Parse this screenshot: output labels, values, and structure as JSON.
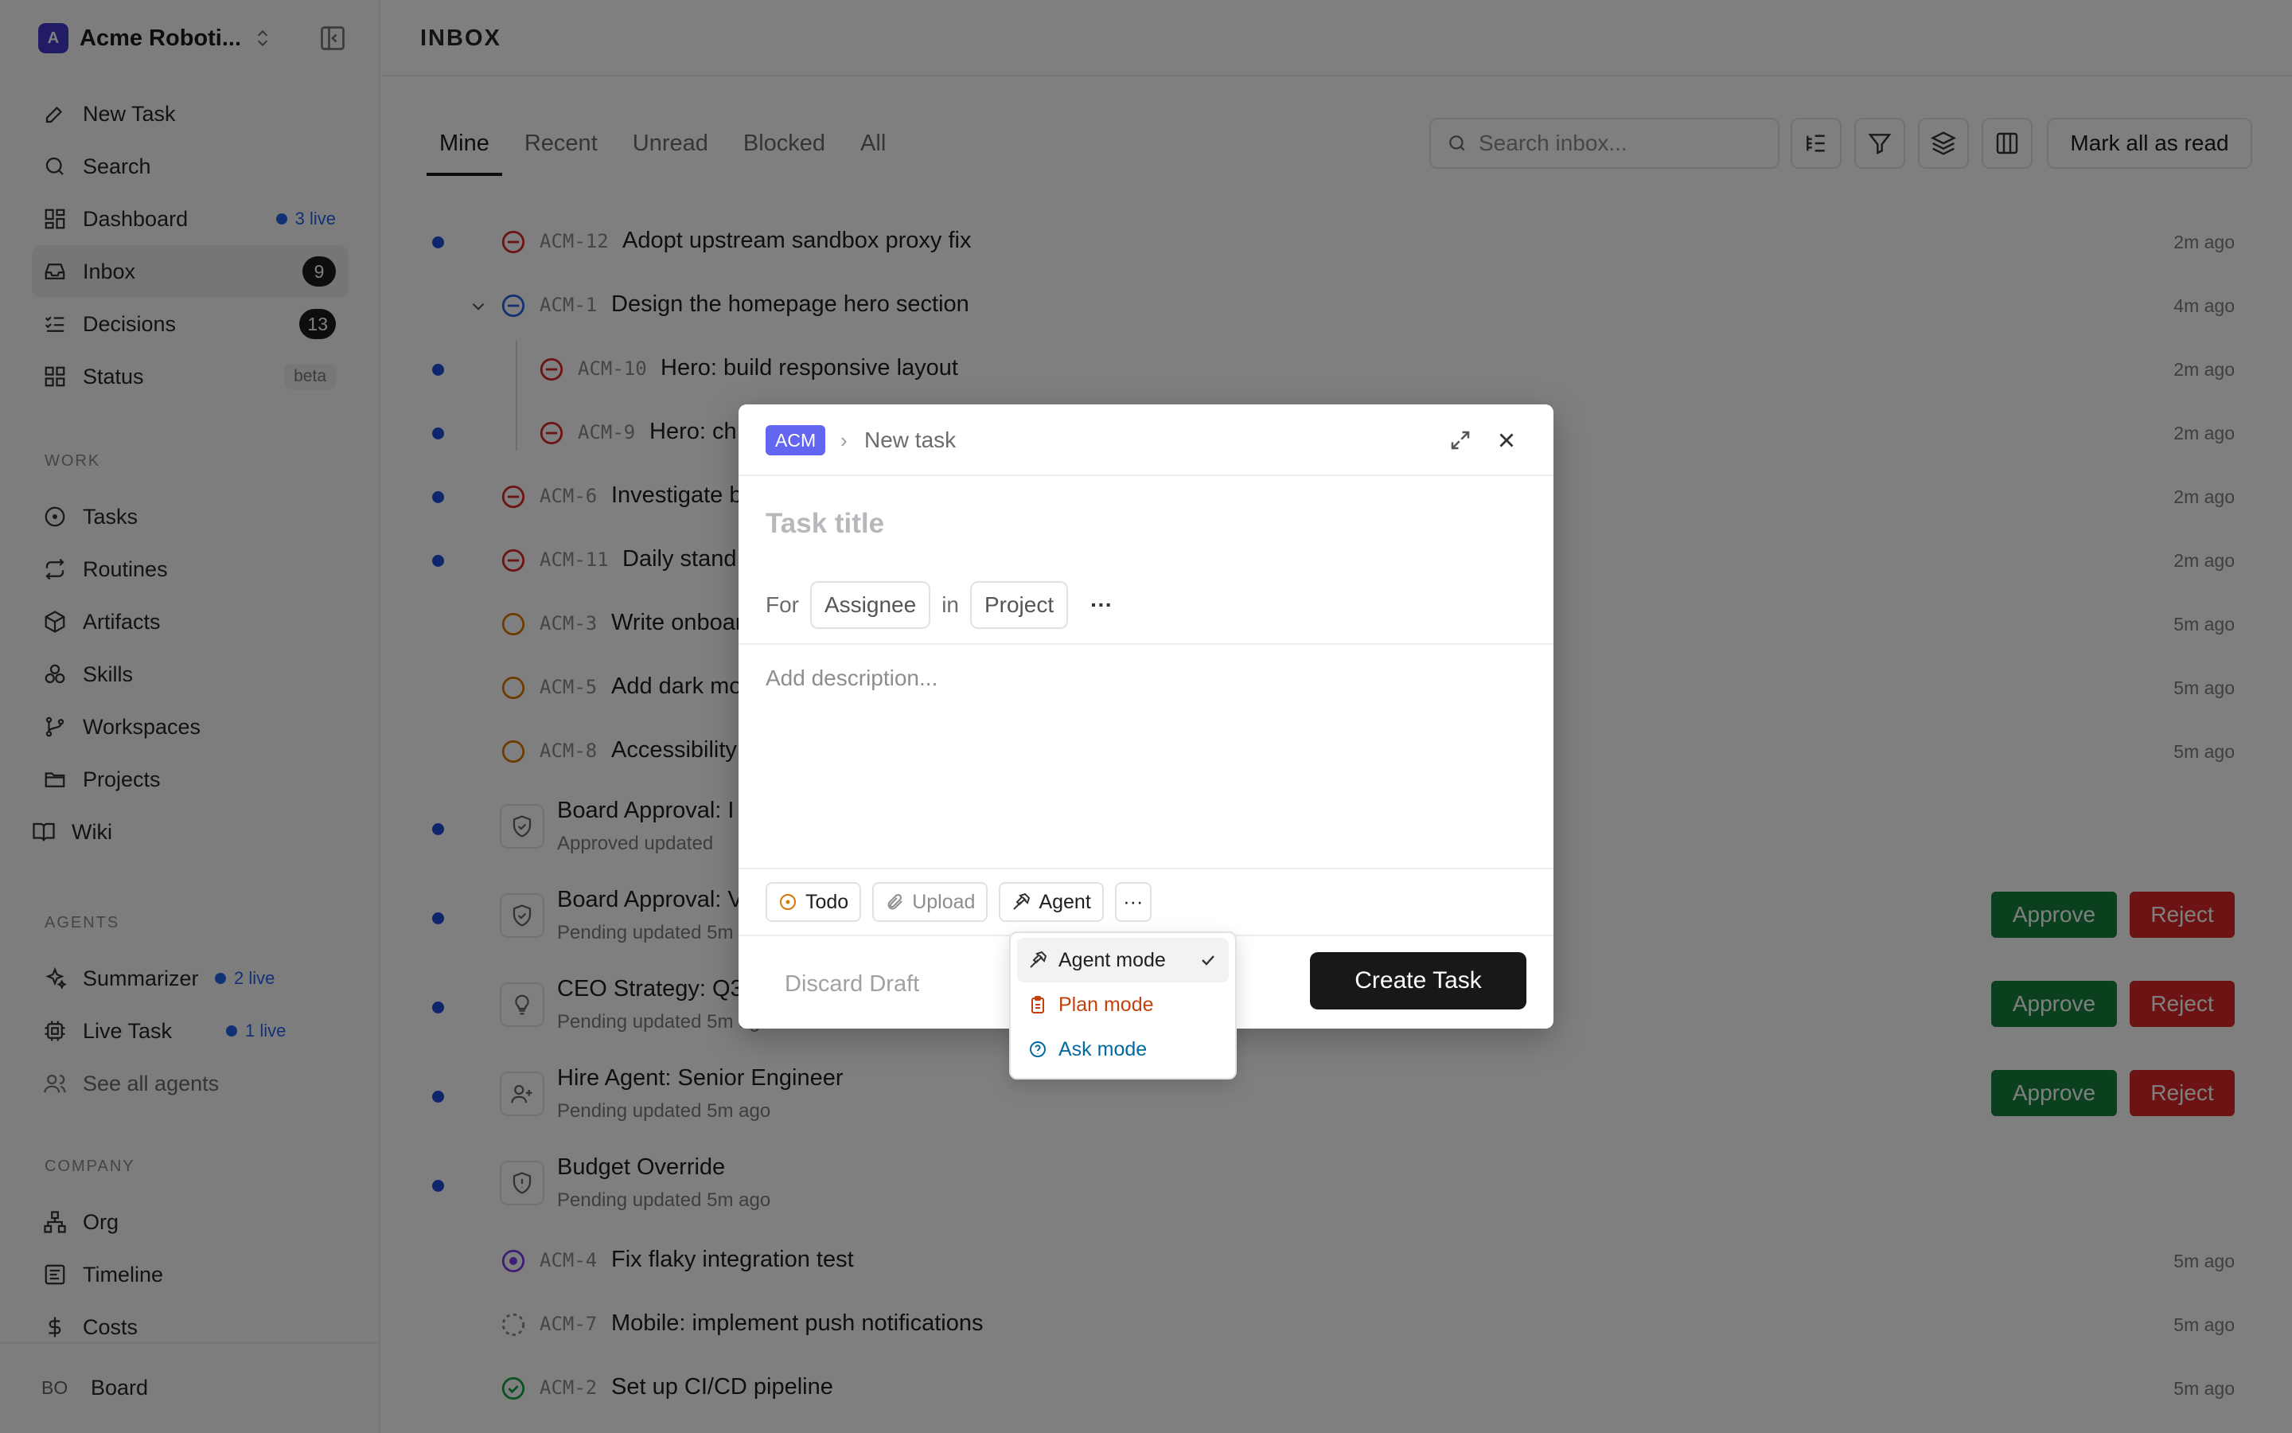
{
  "workspace": {
    "initial": "A",
    "name": "Acme Roboti..."
  },
  "nav": {
    "new_task": "New Task",
    "search": "Search",
    "dashboard": "Dashboard",
    "dashboard_live": "3 live",
    "inbox": "Inbox",
    "inbox_count": "9",
    "decisions": "Decisions",
    "decisions_count": "13",
    "status": "Status",
    "status_badge": "beta",
    "work_label": "WORK",
    "tasks": "Tasks",
    "routines": "Routines",
    "artifacts": "Artifacts",
    "skills": "Skills",
    "workspaces": "Workspaces",
    "projects": "Projects",
    "wiki": "Wiki",
    "agents_label": "AGENTS",
    "summarizer": "Summarizer",
    "summarizer_live": "2 live",
    "live_task": "Live Task",
    "live_task_live": "1 live",
    "see_all_agents": "See all agents",
    "company_label": "COMPANY",
    "org": "Org",
    "timeline": "Timeline",
    "costs": "Costs"
  },
  "user": {
    "initials": "BO",
    "name": "Board"
  },
  "header": {
    "title": "INBOX"
  },
  "tabs": [
    "Mine",
    "Recent",
    "Unread",
    "Blocked",
    "All"
  ],
  "search": {
    "placeholder": "Search inbox..."
  },
  "mark_all_read": "Mark all as read",
  "rows": [
    {
      "code": "ACM-12",
      "title": "Adopt upstream sandbox proxy fix",
      "time": "2m ago"
    },
    {
      "code": "ACM-1",
      "title": "Design the homepage hero section",
      "time": "4m ago"
    },
    {
      "code": "ACM-10",
      "title": "Hero: build responsive layout",
      "time": "2m ago"
    },
    {
      "code": "ACM-9",
      "title": "Hero: ch",
      "time": "2m ago"
    },
    {
      "code": "ACM-6",
      "title": "Investigate b",
      "time": "2m ago"
    },
    {
      "code": "ACM-11",
      "title": "Daily stand",
      "time": "2m ago"
    },
    {
      "code": "ACM-3",
      "title": "Write onboar",
      "time": "5m ago"
    },
    {
      "code": "ACM-5",
      "title": "Add dark mo",
      "time": "5m ago"
    },
    {
      "code": "ACM-8",
      "title": "Accessibility",
      "time": "5m ago"
    }
  ],
  "approvals": [
    {
      "title": "Board Approval: I",
      "sub": "Approved   updated"
    },
    {
      "title": "Board Approval: V",
      "sub": "Pending   updated 5m"
    },
    {
      "title": "CEO Strategy: Q3",
      "sub": "Pending   updated 5m ago"
    },
    {
      "title": "Hire Agent: Senior Engineer",
      "sub": "Pending   updated 5m ago"
    },
    {
      "title": "Budget Override",
      "sub": "Pending   updated 5m ago"
    }
  ],
  "approve_label": "Approve",
  "reject_label": "Reject",
  "bottom_rows": [
    {
      "code": "ACM-4",
      "title": "Fix flaky integration test",
      "time": "5m ago"
    },
    {
      "code": "ACM-7",
      "title": "Mobile: implement push notifications",
      "time": "5m ago"
    },
    {
      "code": "ACM-2",
      "title": "Set up CI/CD pipeline",
      "time": "5m ago"
    }
  ],
  "modal": {
    "project_badge": "ACM",
    "crumb_sep": "›",
    "crumb": "New task",
    "title_placeholder": "Task title",
    "for_label": "For",
    "assignee": "Assignee",
    "in_label": "in",
    "project": "Project",
    "more": "···",
    "desc_placeholder": "Add description...",
    "status": "Todo",
    "upload": "Upload",
    "agent": "Agent",
    "discard": "Discard Draft",
    "create": "Create Task"
  },
  "dropdown": {
    "options": [
      "Agent mode",
      "Plan mode",
      "Ask mode"
    ]
  },
  "colors": {
    "accent": "#6366f1",
    "approve": "#15803d",
    "reject": "#dc2626",
    "live": "#2563eb",
    "plan": "#c2410c",
    "ask": "#0369a1"
  }
}
